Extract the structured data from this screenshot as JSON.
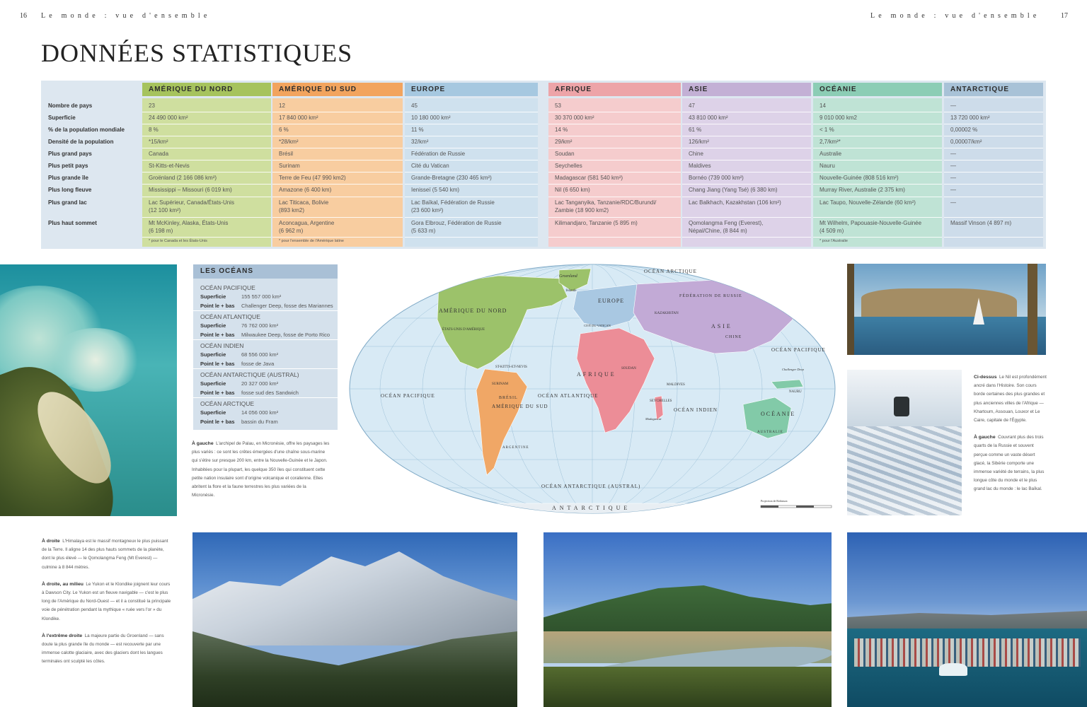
{
  "header": {
    "left_page_number": "16",
    "left_running_title": "Le monde : vue d'ensemble",
    "right_running_title": "Le monde : vue d'ensemble",
    "right_page_number": "17"
  },
  "title": "DONNÉES STATISTIQUES",
  "stats_table": {
    "row_labels": [
      "Nombre de pays",
      "Superficie",
      "% de la population mondiale",
      "Densité de la population",
      "Plus grand pays",
      "Plus petit pays",
      "Plus grande île",
      "Plus long fleuve",
      "Plus grand lac",
      "Plus haut sommet"
    ],
    "columns": [
      {
        "name": "AMÉRIQUE DU NORD",
        "color": "#a6c35d",
        "body_color": "#cfdf9f",
        "values": [
          "23",
          "24 490 000 km²",
          "8 %",
          "*15/km²",
          "Canada",
          "St-Kitts-et-Nevis",
          "Groënland (2 166 086 km²)",
          "Mississippi – Missouri (6 019 km)",
          "Lac Supérieur, Canada/États-Unis\n(12 100 km²)",
          "Mt McKinley, Alaska, États-Unis\n(6 198 m)"
        ],
        "note": "* pour le Canada et les États-Unis"
      },
      {
        "name": "AMÉRIQUE DU SUD",
        "color": "#f2a45e",
        "body_color": "#f8cda0",
        "values": [
          "12",
          "17 840 000 km²",
          "6 %",
          "*28/km²",
          "Brésil",
          "Surinam",
          "Terre de Feu (47 990 km2)",
          "Amazone (6 400 km)",
          "Lac Titicaca, Bolivie\n(893 km2)",
          "Aconcagua, Argentine\n(6 962 m)"
        ],
        "note": "* pour l'ensemble de l'Amérique latine"
      },
      {
        "name": "EUROPE",
        "color": "#a6c8e0",
        "body_color": "#cfe1ee",
        "values": [
          "45",
          "10 180 000 km²",
          "11 %",
          "32/km²",
          "Fédération de Russie",
          "Cité du Vatican",
          "Grande-Bretagne (230 465 km²)",
          "Ienisseï (5 540 km)",
          "Lac Baïkal, Fédération de Russie\n(23 600 km²)",
          "Gora Elbrouz, Fédération de Russie\n(5 633 m)"
        ],
        "note": ""
      },
      {
        "name": "AFRIQUE",
        "color": "#eda4a8",
        "body_color": "#f5cccd",
        "values": [
          "53",
          "30 370 000 km²",
          "14 %",
          "29/km²",
          "Soudan",
          "Seychelles",
          "Madagascar (581 540 km²)",
          "Nil (6 650 km)",
          "Lac Tanganyika, Tanzanie/RDC/Burundi/\nZambie (18 900 km2)",
          "Kilimandjaro, Tanzanie (5 895 m)"
        ],
        "note": ""
      },
      {
        "name": "ASIE",
        "color": "#c3b0d5",
        "body_color": "#ddd2e8",
        "values": [
          "47",
          "43 810 000 km²",
          "61 %",
          "126/km²",
          "Chine",
          "Maldives",
          "Bornéo (739 000 km²)",
          "Chang Jiang (Yang Tsé) (6 380 km)",
          "Lac Balkhach, Kazakhstan (106 km²)",
          "Qomolangma Feng (Everest),\nNépal/Chine, (8 844 m)"
        ],
        "note": ""
      },
      {
        "name": "OCÉANIE",
        "color": "#8ccdb5",
        "body_color": "#bfe3d5",
        "values": [
          "14",
          "9 010 000 km2",
          "< 1 %",
          "2,7/km²*",
          "Australie",
          "Nauru",
          "Nouvelle-Guinée (808 516 km²)",
          "Murray River, Australie (2 375 km)",
          "Lac Taupo, Nouvelle-Zélande (60 km²)",
          "Mt Wilhelm, Papouasie-Nouvelle-Guinée\n(4 509 m)"
        ],
        "note": "* pour l'Australie"
      },
      {
        "name": "ANTARCTIQUE",
        "color": "#a8c2d7",
        "body_color": "#cddcea",
        "values": [
          "—",
          "13 720 000 km²",
          "0,00002 %",
          "0,00007/km²",
          "—",
          "—",
          "—",
          "—",
          "—",
          "Massif Vinson (4 897 m)"
        ],
        "note": ""
      }
    ]
  },
  "oceans_box": {
    "title": "LES OCÉANS",
    "area_label": "Superficie",
    "depth_label": "Point le + bas",
    "oceans": [
      {
        "name": "OCÉAN PACIFIQUE",
        "area": "155 557 000 km²",
        "deepest": "Challenger Deep, fosse des Mariannes"
      },
      {
        "name": "OCÉAN ATLANTIQUE",
        "area": "76 762 000 km²",
        "deepest": "Milwaukee Deep, fosse de Porto Rico"
      },
      {
        "name": "OCÉAN INDIEN",
        "area": "68 556 000 km²",
        "deepest": "fosse de Java"
      },
      {
        "name": "OCÉAN ANTARCTIQUE (AUSTRAL)",
        "area": "20 327 000 km²",
        "deepest": "fosse sud des Sandwich"
      },
      {
        "name": "OCÉAN ARCTIQUE",
        "area": "14 056 000 km²",
        "deepest": "bassin du Fram"
      }
    ]
  },
  "captions": {
    "left": {
      "lead": "À gauche",
      "text": "L'archipel de Palau, en Micronésie, offre les paysages les plus variés : ce sont les crêtes émergées d'une chaîne sous-marine qui s'étire sur presque 200 km, entre la Nouvelle-Guinée et le Japon. Inhabitées pour la plupart, les quelque 350 îles qui constituent cette petite nation insulaire sont d'origine volcanique et coralienne. Elles abritent la flore et la faune terrestres les plus variées de la Micronésie."
    },
    "bottom_left": [
      {
        "lead": "À droite",
        "text": "L'Himalaya est le massif montagneux le plus puissant de la Terre. Il aligne 14 des plus hauts sommets de la planète, dont le plus élevé — le Qomolangma Feng (Mt Everest) — culmine à 8 844 mètres."
      },
      {
        "lead": "À droite, au milieu",
        "text": "Le Yukon et le Klondike joignent leur cours à Dawson City. Le Yukon est un fleuve navigable — c'est le plus long de l'Amérique du Nord-Ouest — et il a constitué la principale voie de pénétration pendant la mythique « ruée vers l'or » du Klondike."
      },
      {
        "lead": "À l'extrême droite",
        "text": "La majeure partie du Groenland — sans doute la plus grande île du monde — est recouverte par une immense calotte glaciaire, avec des glaciers dont les langues terminales ont sculpté les côtes."
      }
    ],
    "right": [
      {
        "lead": "Ci-dessus",
        "text": "Le Nil est profondément ancré dans l'Histoire. Son cours borde certaines des plus grandes et plus anciennes villes de l'Afrique — Khartoum, Assouan, Louxor et Le Caire, capitale de l'Égypte."
      },
      {
        "lead": "À gauche",
        "text": "Couvrant plus des trois quarts de la Russie et souvent perçue comme un vaste désert glacé, la Sibérie comporte une immense variété de terrains, la plus longue côte du monde et le plus grand lac du monde : le lac Baïkal."
      }
    ]
  },
  "map_labels": {
    "ocean_arctique": "OCÉAN ARCTIQUE",
    "groenland": "Groenland",
    "islande": "Islande",
    "amerique_du_nord": "AMÉRIQUE DU NORD",
    "etats_unis": "ÉTATS-UNIS D'AMÉRIQUE",
    "st_kitts": "ST-KITTS-ET-NEVIS",
    "ocean_pacifique_w": "OCÉAN PACIFIQUE",
    "ocean_pacifique_e": "OCÉAN PACIFIQUE",
    "ocean_atlantique": "OCÉAN ATLANTIQUE",
    "ocean_indien": "OCÉAN INDIEN",
    "ocean_antarctique": "OCÉAN ANTARCTIQUE (AUSTRAL)",
    "antarctique": "ANTARCTIQUE",
    "europe": "EUROPE",
    "federation_russie": "FÉDÉRATION DE RUSSIE",
    "kazakhstan": "KAZAKHSTAN",
    "asie": "ASIE",
    "chine": "CHINE",
    "afrique": "AFRIQUE",
    "soudan": "SOUDAN",
    "seychelles": "SEYCHELLES",
    "maldives": "MALDIVES",
    "madagascar": "Madagascar",
    "surinam": "SURINAM",
    "bresil": "BRÉSIL",
    "amerique_du_sud": "AMÉRIQUE DU SUD",
    "argentine": "ARGENTINE",
    "cite_vatican": "CITÉ DU VATICAN",
    "nauru": "NAURU",
    "oceanie": "OCÉANIE",
    "australie": "AUSTRALIE",
    "challenger_deep": "Challenger Deep",
    "projection": "Projection de Robinson"
  }
}
